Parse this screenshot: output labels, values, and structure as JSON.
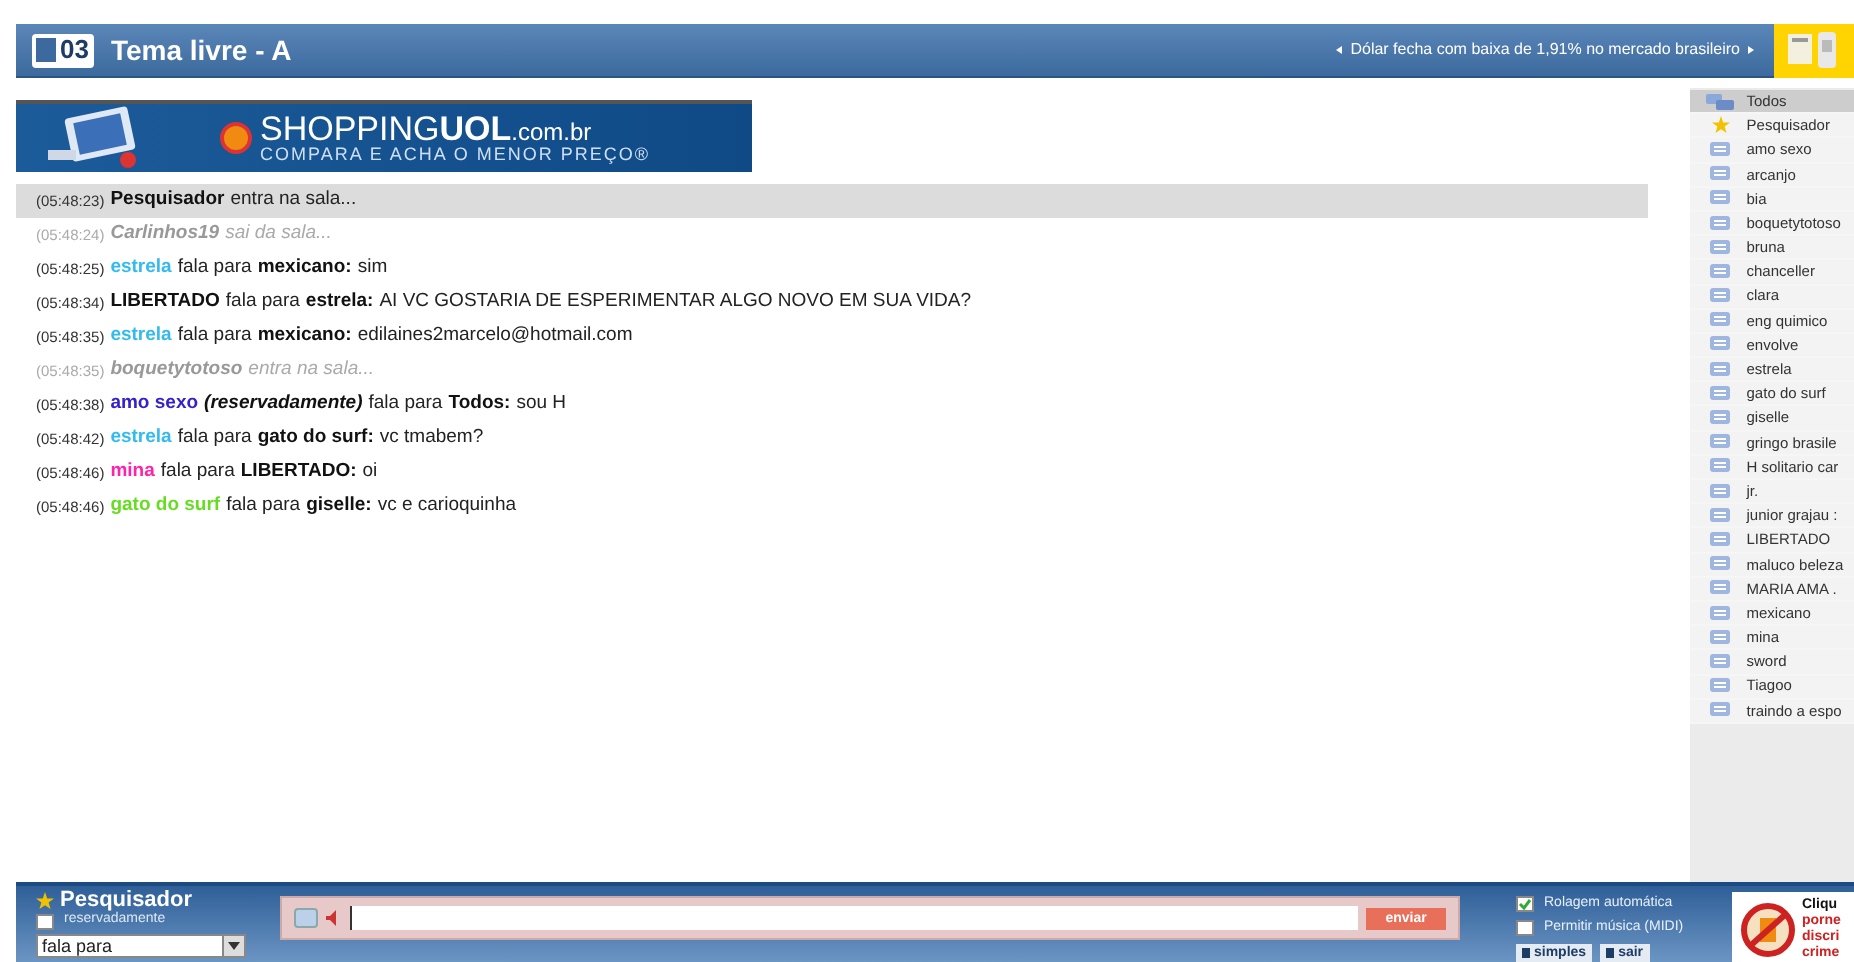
{
  "header": {
    "room_number": "03",
    "title": "Tema livre - A",
    "ticker": "Dólar fecha com baixa de 1,91% no mercado brasileiro"
  },
  "banner": {
    "brand": "SHOPPING",
    "brand_bold": "UOL",
    "domain": ".com.br",
    "tagline": "COMPARA E ACHA O MENOR PREÇO®"
  },
  "messages": [
    {
      "time": "(05:48:23)",
      "kind": "event",
      "muted": false,
      "highlighted": true,
      "from": "Pesquisador",
      "action": "entra na sala..."
    },
    {
      "time": "(05:48:24)",
      "kind": "event",
      "muted": true,
      "highlighted": false,
      "from": "Carlinhos19",
      "action": "sai da sala..."
    },
    {
      "time": "(05:48:25)",
      "kind": "speech",
      "highlighted": false,
      "from": "estrela",
      "color": "#33bbee",
      "verb": "fala para",
      "to": "mexicano:",
      "text": "sim"
    },
    {
      "time": "(05:48:34)",
      "kind": "speech",
      "highlighted": false,
      "from": "LIBERTADO",
      "color": "#111111",
      "verb": "fala para",
      "to": "estrela:",
      "text": "AI VC GOSTARIA DE ESPERIMENTAR ALGO NOVO EM SUA VIDA?"
    },
    {
      "time": "(05:48:35)",
      "kind": "speech",
      "highlighted": false,
      "from": "estrela",
      "color": "#33bbee",
      "verb": "fala para",
      "to": "mexicano:",
      "text": "edilaines2marcelo@hotmail.com"
    },
    {
      "time": "(05:48:35)",
      "kind": "event",
      "muted": true,
      "highlighted": false,
      "from": "boquetytotoso",
      "action": "entra na sala..."
    },
    {
      "time": "(05:48:38)",
      "kind": "speech",
      "highlighted": false,
      "from": "amo sexo",
      "color": "#3322cc",
      "reserved": "(reservadamente)",
      "verb": "fala para",
      "to": "Todos:",
      "text": "sou H"
    },
    {
      "time": "(05:48:42)",
      "kind": "speech",
      "highlighted": false,
      "from": "estrela",
      "color": "#33bbee",
      "verb": "fala para",
      "to": "gato do surf:",
      "text": "vc tmabem?"
    },
    {
      "time": "(05:48:46)",
      "kind": "speech",
      "highlighted": false,
      "from": "mina",
      "color": "#ff22aa",
      "verb": "fala para",
      "to": "LIBERTADO:",
      "text": "oi"
    },
    {
      "time": "(05:48:46)",
      "kind": "speech",
      "highlighted": false,
      "from": "gato do surf",
      "color": "#66dd22",
      "verb": "fala para",
      "to": "giselle:",
      "text": "vc e carioquinha"
    }
  ],
  "users": [
    {
      "kind": "all",
      "name": "Todos"
    },
    {
      "kind": "self",
      "name": "Pesquisador"
    },
    {
      "kind": "user",
      "name": "amo sexo"
    },
    {
      "kind": "user",
      "name": "arcanjo"
    },
    {
      "kind": "user",
      "name": "bia"
    },
    {
      "kind": "user",
      "name": "boquetytotoso"
    },
    {
      "kind": "user",
      "name": "bruna"
    },
    {
      "kind": "user",
      "name": "chanceller"
    },
    {
      "kind": "user",
      "name": "clara"
    },
    {
      "kind": "user",
      "name": "eng quimico"
    },
    {
      "kind": "user",
      "name": "envolve"
    },
    {
      "kind": "user",
      "name": "estrela"
    },
    {
      "kind": "user",
      "name": "gato do surf"
    },
    {
      "kind": "user",
      "name": "giselle"
    },
    {
      "kind": "user",
      "name": "gringo brasile"
    },
    {
      "kind": "user",
      "name": "H solitario car"
    },
    {
      "kind": "user",
      "name": "jr."
    },
    {
      "kind": "user",
      "name": "junior grajau :"
    },
    {
      "kind": "user",
      "name": "LIBERTADO"
    },
    {
      "kind": "user",
      "name": "maluco beleza"
    },
    {
      "kind": "user",
      "name": "MARIA AMA ."
    },
    {
      "kind": "user",
      "name": "mexicano"
    },
    {
      "kind": "user",
      "name": "mina"
    },
    {
      "kind": "user",
      "name": "sword"
    },
    {
      "kind": "user",
      "name": "Tiagoo"
    },
    {
      "kind": "user",
      "name": "traindo a espo"
    }
  ],
  "composer": {
    "nickname": "Pesquisador",
    "private": {
      "label": "reservadamente",
      "checked": false
    },
    "target": "fala para",
    "send": "enviar",
    "options": [
      {
        "label": "Rolagem automática",
        "checked": true
      },
      {
        "label": "Permitir música (MIDI)",
        "checked": false
      }
    ],
    "buttons": [
      "simples",
      "sair"
    ]
  },
  "ad": {
    "lines": [
      "Cliqu",
      "porne",
      "discri",
      "crime"
    ]
  }
}
